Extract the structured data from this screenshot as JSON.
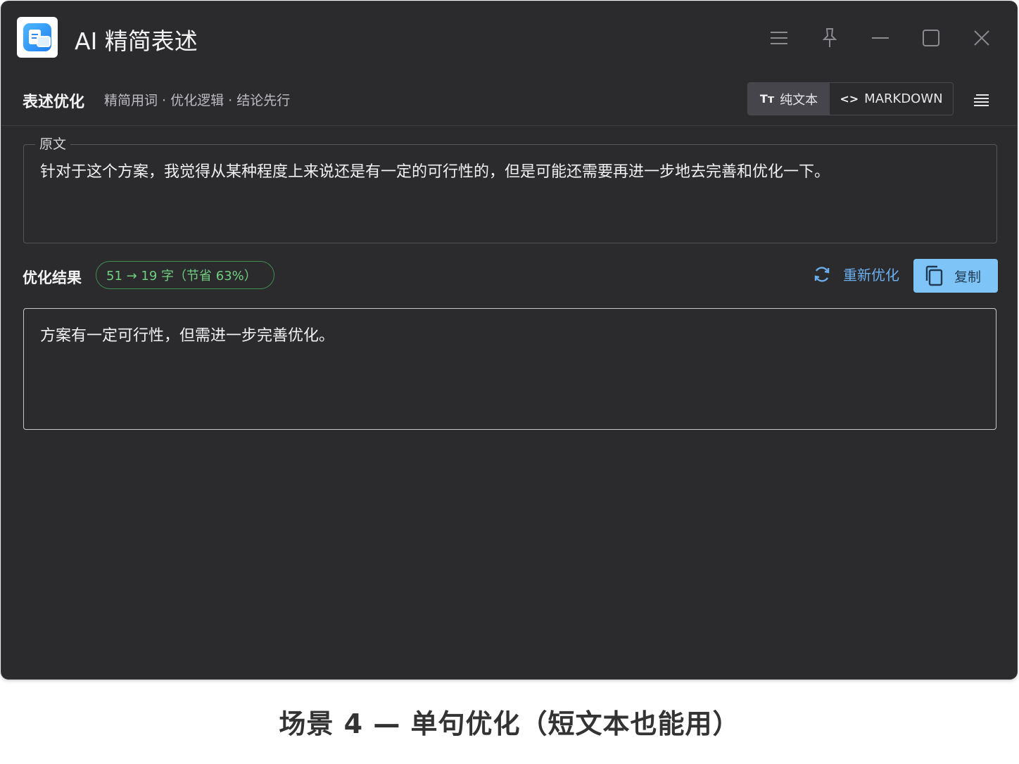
{
  "app": {
    "title": "AI 精简表述",
    "icon": "app-logo-icon"
  },
  "window_controls": [
    "menu-icon",
    "pin-icon",
    "minimize-icon",
    "maximize-icon",
    "close-icon"
  ],
  "toolbar": {
    "section_title": "表述优化",
    "section_subtitle": "精简用词 · 优化逻辑 · 结论先行",
    "format_toggle": [
      {
        "label": "纯文本",
        "icon": "Tт",
        "active": true
      },
      {
        "label": "MARKDOWN",
        "icon": "<>",
        "active": false
      }
    ],
    "menu_icon": "text-align-icon"
  },
  "original": {
    "legend": "原文",
    "text": "针对于这个方案，我觉得从某种程度上来说还是有一定的可行性的，但是可能还需要再进一步地去完善和优化一下。"
  },
  "result": {
    "label": "优化结果",
    "badge": "51 → 19 字（节省 63%）",
    "reoptimize_label": "重新优化",
    "copy_label": "复制",
    "text": "方案有一定可行性，但需进一步完善优化。"
  },
  "caption": "场景 4 — 单句优化（短文本也能用）",
  "colors": {
    "window_bg": "#2b2b2e",
    "accent_blue": "#6ab0f0",
    "copy_button_bg": "#7fc4f7",
    "badge_green": "#6fcf7f"
  }
}
